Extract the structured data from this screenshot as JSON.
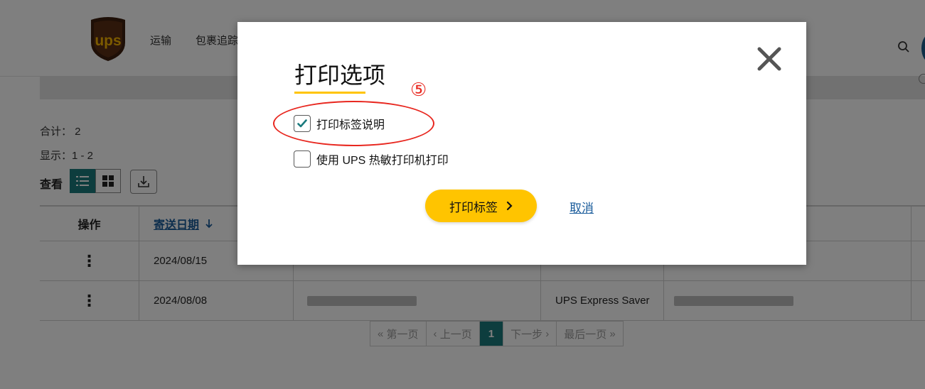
{
  "header": {
    "logo_text": "ups",
    "nav": [
      "运输",
      "包裹追踪"
    ]
  },
  "summary": {
    "total": "合计： 2",
    "showing": "显示：1 - 2"
  },
  "view": {
    "label": "查看"
  },
  "table": {
    "headers": {
      "action": "操作",
      "ship_date": "寄送日期"
    },
    "rows": [
      {
        "date": "2024/08/15",
        "service": ""
      },
      {
        "date": "2024/08/08",
        "service": "UPS Express Saver"
      }
    ]
  },
  "pagination": {
    "first": "第一页",
    "prev": "上一页",
    "current": "1",
    "next": "下一步",
    "last": "最后一页"
  },
  "modal": {
    "title": "打印选项",
    "step_marker": "⑤",
    "options": [
      {
        "label": "打印标签说明",
        "checked": true
      },
      {
        "label": "使用 UPS 热敏打印机打印",
        "checked": false
      }
    ],
    "print_button": "打印标签",
    "cancel_link": "取消"
  },
  "colors": {
    "brand_teal": "#1a7a7d",
    "accent_yellow": "#ffc400",
    "annotation_red": "#e8271f",
    "link_blue": "#1a5c9b"
  }
}
